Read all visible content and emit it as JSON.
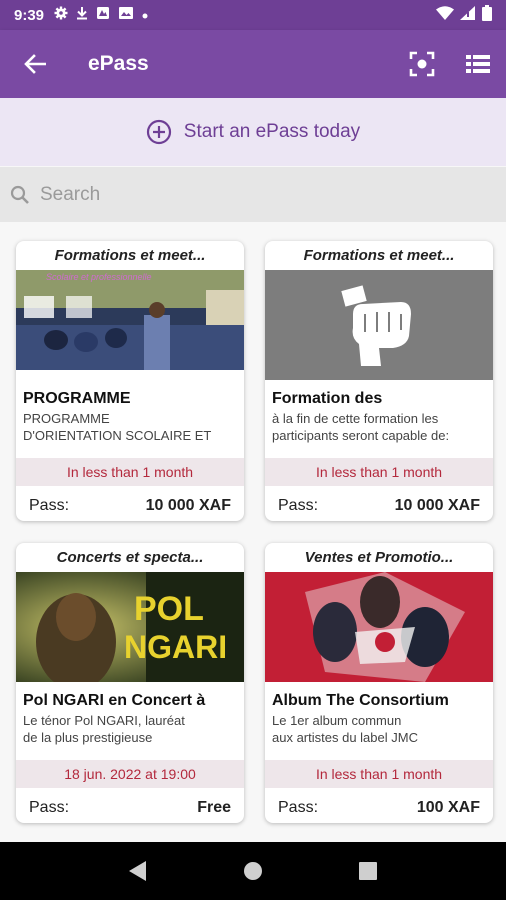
{
  "status_bar": {
    "time": "9:39",
    "icons": [
      "gear-icon",
      "download-icon",
      "image-icon",
      "picture-icon",
      "dot-icon",
      "wifi-icon",
      "signal-icon",
      "battery-icon"
    ]
  },
  "app_bar": {
    "title": "ePass",
    "back_icon": "arrow-left-icon",
    "actions": [
      "qr-scan-icon",
      "list-view-icon"
    ]
  },
  "start_banner": {
    "label": "Start an ePass today",
    "icon": "plus-circle-icon"
  },
  "search": {
    "placeholder": "Search"
  },
  "colors": {
    "primary": "#7a4aa3",
    "status_bar": "#6e3f95",
    "banner_bg": "#ece6f4",
    "date_text": "#b3283c"
  },
  "cards": [
    {
      "category": "Formations et meet...",
      "title": "PROGRAMME",
      "description_line1": "PROGRAMME",
      "description_line2": "D'ORIENTATION SCOLAIRE ET",
      "when": "In less than 1 month",
      "pass_label": "Pass:",
      "price": "10 000 XAF"
    },
    {
      "category": "Formations et meet...",
      "title": "Formation des",
      "description_line1": "à la fin de cette formation les",
      "description_line2": "participants seront capable de:",
      "when": "In less than 1 month",
      "pass_label": "Pass:",
      "price": "10 000 XAF"
    },
    {
      "category": "Concerts et specta...",
      "title": "Pol NGARI en Concert à",
      "description_line1": "Le ténor Pol NGARI, lauréat",
      "description_line2": "de la plus prestigieuse",
      "when": "18 jun. 2022 at 19:00",
      "pass_label": "Pass:",
      "price": "Free"
    },
    {
      "category": "Ventes et Promotio...",
      "title": "Album The Consortium",
      "description_line1": "Le 1er album commun",
      "description_line2": "aux artistes du label JMC",
      "when": "In less than 1 month",
      "pass_label": "Pass:",
      "price": "100 XAF"
    }
  ],
  "nav_bar": {
    "buttons": [
      "back-triangle-icon",
      "home-circle-icon",
      "recents-square-icon"
    ]
  }
}
